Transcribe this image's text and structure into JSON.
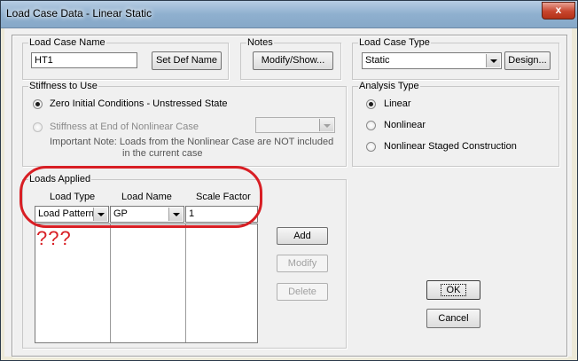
{
  "window": {
    "title": "Load Case Data - Linear Static",
    "close_glyph": "x"
  },
  "load_case_name": {
    "label": "Load Case Name",
    "value": "HT1",
    "set_def_name_button": "Set Def Name"
  },
  "notes": {
    "label": "Notes",
    "button": "Modify/Show..."
  },
  "load_case_type": {
    "label": "Load Case Type",
    "value": "Static",
    "design_button": "Design..."
  },
  "stiffness": {
    "label": "Stiffness to Use",
    "option_zero": "Zero Initial Conditions - Unstressed State",
    "option_nonlinear": "Stiffness at End of Nonlinear Case",
    "note_line1": "Important Note:   Loads from the Nonlinear Case are NOT included",
    "note_line2": "in the current case"
  },
  "analysis_type": {
    "label": "Analysis Type",
    "options": [
      "Linear",
      "Nonlinear",
      "Nonlinear Staged Construction"
    ],
    "selected": "Linear"
  },
  "loads_applied": {
    "label": "Loads Applied",
    "headers": [
      "Load Type",
      "Load Name",
      "Scale Factor"
    ],
    "row": {
      "load_type": "Load Pattern",
      "load_name": "GP",
      "scale_factor": "1"
    },
    "buttons": {
      "add": "Add",
      "modify": "Modify",
      "delete": "Delete"
    }
  },
  "annotation": {
    "text": "???",
    "color": "#d81e24"
  },
  "footer": {
    "ok": "OK",
    "cancel": "Cancel"
  }
}
